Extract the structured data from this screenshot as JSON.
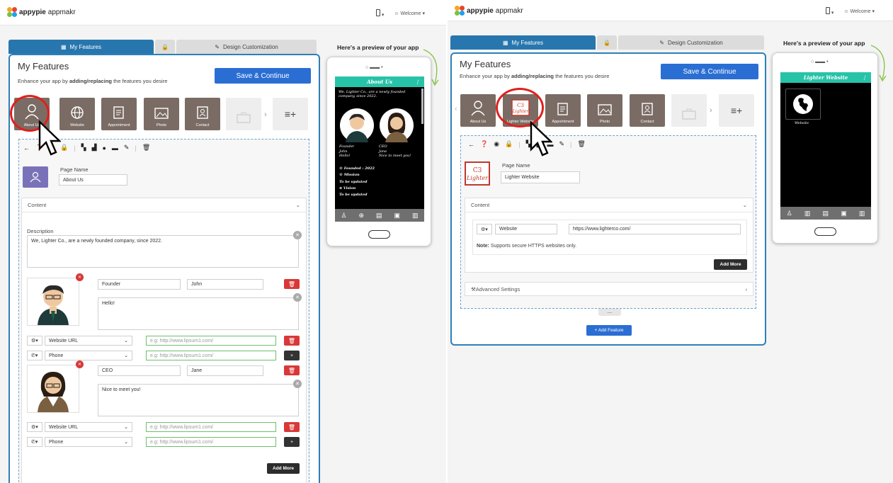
{
  "brand": {
    "name_bold": "appypie",
    "name_rest": "appmakr"
  },
  "topbar": {
    "device_menu": "▾",
    "welcome": "Welcome ▾"
  },
  "tabs": {
    "features": "My Features",
    "design": "Design Customization"
  },
  "main": {
    "title": "My Features",
    "subtitle_pre": "Enhance your app by ",
    "subtitle_bold": "adding/replacing",
    "subtitle_post": " the features you desire",
    "save": "Save & Continue"
  },
  "preview_title": "Here's a preview of your app",
  "left": {
    "features": [
      {
        "label": "About Us",
        "icon": "person-icon"
      },
      {
        "label": "Website",
        "icon": "globe-icon"
      },
      {
        "label": "Appointment",
        "icon": "appointment-icon"
      },
      {
        "label": "Photo",
        "icon": "photo-icon"
      },
      {
        "label": "Contact",
        "icon": "contact-icon"
      }
    ],
    "page_name_label": "Page Name",
    "page_name_value": "About Us",
    "content_label": "Content",
    "description_label": "Description",
    "description_value": "We, Lighter Co., are a newly founded company, since 2022.",
    "person1": {
      "role": "Founder",
      "name": "John",
      "message": "Hello!"
    },
    "person2": {
      "role": "CEO",
      "name": "Jane",
      "message": "Nice to meet you!"
    },
    "link_select": "Website URL",
    "phone_select": "Phone",
    "url_placeholder": "e.g: http://www.lipsum1.com/",
    "add_more": "Add More",
    "preview": {
      "app_title": "About Us",
      "desc": "We, Lighter Co., are a newly founded company, since 2022.",
      "p1_role": "Founder",
      "p1_name": "John",
      "p1_msg": "Hello!",
      "p2_role": "CEO",
      "p2_name": "Jane",
      "p2_msg": "Nice to meet you!",
      "founded": "© Founded : 2022",
      "mission": "© Mission",
      "mission_text": "To be updated",
      "vision": "⊘ Vision",
      "vision_text": "To be updated"
    }
  },
  "right": {
    "features": [
      {
        "label": "About Us",
        "icon": "person-icon"
      },
      {
        "label": "Lighter Website",
        "icon": "lighter-logo-icon"
      },
      {
        "label": "Appointment",
        "icon": "appointment-icon"
      },
      {
        "label": "Photo",
        "icon": "photo-icon"
      },
      {
        "label": "Contact",
        "icon": "contact-icon"
      }
    ],
    "page_name_label": "Page Name",
    "page_name_value": "Lighter Website",
    "content_label": "Content",
    "type_select": "Website",
    "url_value": "https://www.lighterco.com/",
    "note_bold": "Note:",
    "note_text": " Supports secure HTTPS websites only.",
    "add_more": "Add More",
    "advanced": "Advanced Settings",
    "add_feature": "+ Add Feature",
    "preview": {
      "app_title": "Lighter Website",
      "tile_label": "Website"
    }
  },
  "colors": {
    "accent": "#2876ae",
    "save": "#2b6ed3",
    "teal": "#27c3a8",
    "feature_bg": "#7a6c64",
    "delete": "#d93838"
  }
}
